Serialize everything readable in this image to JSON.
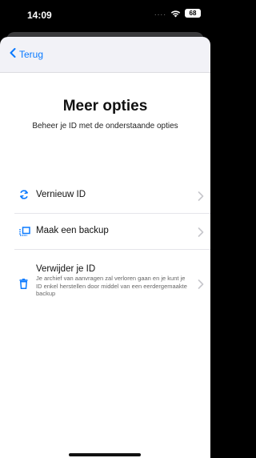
{
  "status_bar": {
    "time": "14:09",
    "signal": "....",
    "battery": "68"
  },
  "nav": {
    "back_label": "Terug"
  },
  "main": {
    "title": "Meer opties",
    "subtitle": "Beheer je ID met de onderstaande opties"
  },
  "options": [
    {
      "label": "Vernieuw ID",
      "icon": "refresh-icon"
    },
    {
      "label": "Maak een backup",
      "icon": "backup-icon"
    },
    {
      "label": "Verwijder je ID",
      "description": "Je archief van aanvragen zal verloren gaan en je kunt je ID enkel herstellen door middel van een eerdergemaakte backup",
      "icon": "trash-icon"
    }
  ],
  "colors": {
    "accent": "#0a7aff",
    "background": "#ffffff",
    "nav_background": "#f2f2f7"
  }
}
